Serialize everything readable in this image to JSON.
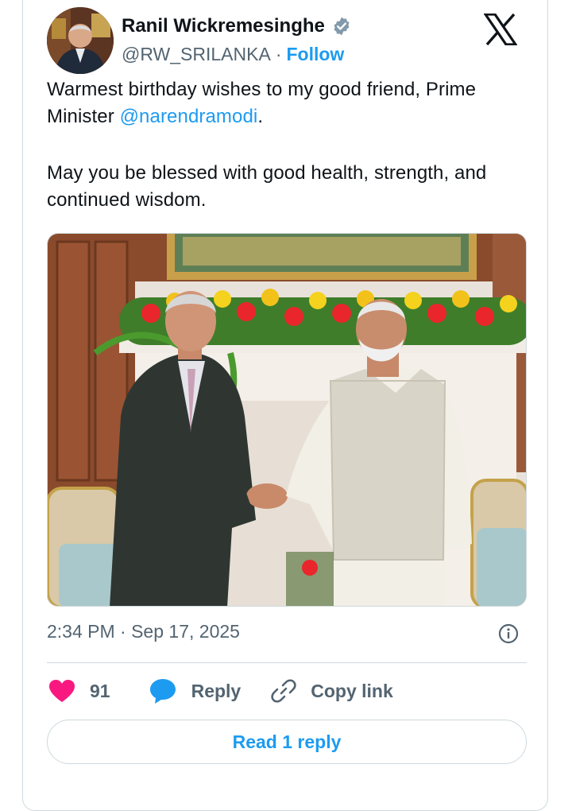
{
  "author": {
    "name": "Ranil Wickremesinghe",
    "handle": "@RW_SRILANKA",
    "separator": "·",
    "follow_label": "Follow",
    "verified": true,
    "avatar_icon": "profile-photo"
  },
  "brand_icon": "x-logo",
  "tweet": {
    "line1_prefix": "Warmest birthday wishes to my good friend, Prime Minister ",
    "mention": "@narendramodi",
    "line1_suffix": ".",
    "line2": "May you be blessed with good health, strength, and continued wisdom."
  },
  "media": {
    "type": "photo",
    "subject": "handshake"
  },
  "meta": {
    "timestamp": "2:34 PM · Sep 17, 2025",
    "info_icon": "info-icon"
  },
  "actions": {
    "like_icon": "heart-icon",
    "like_count": "91",
    "reply_icon": "speech-bubble-icon",
    "reply_label": "Reply",
    "copy_icon": "link-icon",
    "copy_label": "Copy link"
  },
  "read_replies_label": "Read 1 reply",
  "colors": {
    "accent": "#1d9bf0",
    "like": "#f91880",
    "text": "#0f1419",
    "muted": "#536471",
    "border": "#cfd9de"
  }
}
